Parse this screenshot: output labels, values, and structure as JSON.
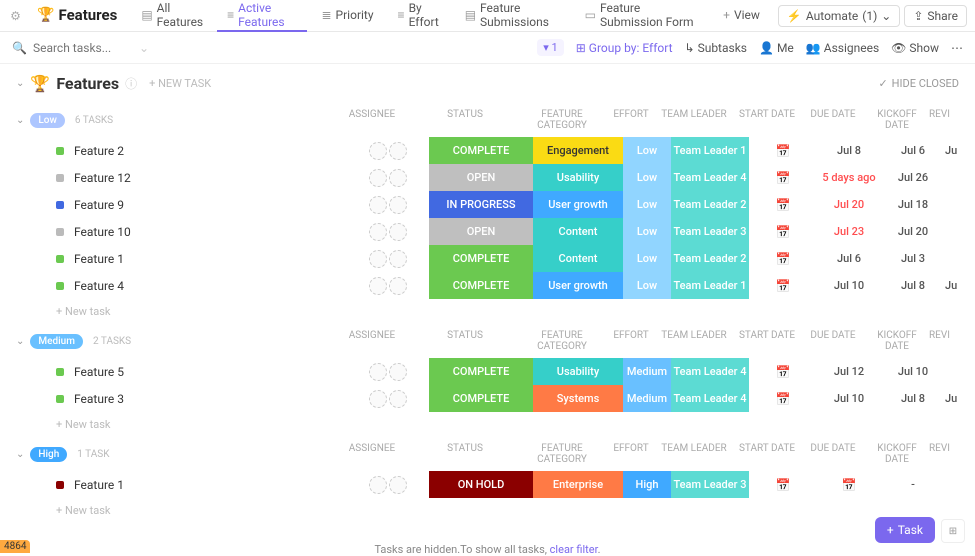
{
  "header": {
    "title": "Features",
    "tabs": [
      "All Features",
      "Active Features",
      "Priority",
      "By Effort",
      "Feature Submissions",
      "Feature Submission Form"
    ],
    "active_tab": "Active Features",
    "view": "View",
    "automate": "Automate",
    "automate_count": "(1)",
    "share": "Share"
  },
  "toolbar": {
    "search_placeholder": "Search tasks...",
    "filter_count": "1",
    "group_by": "Group by: Effort",
    "subtasks": "Subtasks",
    "me": "Me",
    "assignees": "Assignees",
    "show": "Show"
  },
  "list_header": {
    "title": "Features",
    "new_task": "+ NEW TASK",
    "hide_closed": "HIDE CLOSED"
  },
  "columns": [
    "ASSIGNEE",
    "STATUS",
    "FEATURE CATEGORY",
    "EFFORT",
    "TEAM LEADER",
    "START DATE",
    "DUE DATE",
    "KICKOFF DATE",
    "REVI"
  ],
  "groups": [
    {
      "label": "Low",
      "pill_class": "low",
      "count": "6 TASKS",
      "tasks": [
        {
          "dot": "green",
          "name": "Feature 2",
          "status": "COMPLETE",
          "status_class": "st-complete",
          "category": "Engagement",
          "cat_class": "cat-engagement",
          "effort": "Low",
          "eff_class": "eff-low",
          "leader": "Team Leader 1",
          "due": "Jul 8",
          "overdue": false,
          "kickoff": "Jul 6",
          "revi": "Ju"
        },
        {
          "dot": "gray",
          "name": "Feature 12",
          "status": "OPEN",
          "status_class": "st-open",
          "category": "Usability",
          "cat_class": "cat-usability",
          "effort": "Low",
          "eff_class": "eff-low",
          "leader": "Team Leader 4",
          "due": "5 days ago",
          "overdue": true,
          "kickoff": "Jul 26",
          "revi": ""
        },
        {
          "dot": "blue",
          "name": "Feature 9",
          "status": "IN PROGRESS",
          "status_class": "st-progress",
          "category": "User growth",
          "cat_class": "cat-growth",
          "effort": "Low",
          "eff_class": "eff-low",
          "leader": "Team Leader 2",
          "due": "Jul 20",
          "overdue": true,
          "kickoff": "Jul 18",
          "revi": ""
        },
        {
          "dot": "gray",
          "name": "Feature 10",
          "status": "OPEN",
          "status_class": "st-open",
          "category": "Content",
          "cat_class": "cat-content",
          "effort": "Low",
          "eff_class": "eff-low",
          "leader": "Team Leader 3",
          "due": "Jul 23",
          "overdue": true,
          "kickoff": "Jul 20",
          "revi": ""
        },
        {
          "dot": "green",
          "name": "Feature 1",
          "status": "COMPLETE",
          "status_class": "st-complete",
          "category": "Content",
          "cat_class": "cat-content",
          "effort": "Low",
          "eff_class": "eff-low",
          "leader": "Team Leader 2",
          "due": "Jul 6",
          "overdue": false,
          "kickoff": "Jul 3",
          "revi": ""
        },
        {
          "dot": "green",
          "name": "Feature 4",
          "status": "COMPLETE",
          "status_class": "st-complete",
          "category": "User growth",
          "cat_class": "cat-growth",
          "effort": "Low",
          "eff_class": "eff-low",
          "leader": "Team Leader 1",
          "due": "Jul 10",
          "overdue": false,
          "kickoff": "Jul 8",
          "revi": "Ju"
        }
      ]
    },
    {
      "label": "Medium",
      "pill_class": "medium",
      "count": "2 TASKS",
      "tasks": [
        {
          "dot": "green",
          "name": "Feature 5",
          "status": "COMPLETE",
          "status_class": "st-complete",
          "category": "Usability",
          "cat_class": "cat-usability",
          "effort": "Medium",
          "eff_class": "eff-medium",
          "leader": "Team Leader 4",
          "due": "Jul 12",
          "overdue": false,
          "kickoff": "Jul 10",
          "revi": ""
        },
        {
          "dot": "green",
          "name": "Feature 3",
          "status": "COMPLETE",
          "status_class": "st-complete",
          "category": "Systems",
          "cat_class": "cat-systems",
          "effort": "Medium",
          "eff_class": "eff-medium",
          "leader": "Team Leader 4",
          "due": "Jul 10",
          "overdue": false,
          "kickoff": "Jul 8",
          "revi": "Ju"
        }
      ]
    },
    {
      "label": "High",
      "pill_class": "high",
      "count": "1 TASK",
      "tasks": [
        {
          "dot": "dark",
          "name": "Feature 1",
          "status": "ON HOLD",
          "status_class": "st-hold",
          "category": "Enterprise",
          "cat_class": "cat-enterprise",
          "effort": "High",
          "eff_class": "eff-high",
          "leader": "Team Leader 3",
          "due": "",
          "overdue": false,
          "kickoff": "-",
          "revi": ""
        }
      ]
    }
  ],
  "new_task_label": "+ New task",
  "footer": {
    "hidden_text": "Tasks are hidden.To show all tasks, ",
    "clear_filter": "clear filter"
  },
  "fab": "Task",
  "bottom_id": "4864"
}
